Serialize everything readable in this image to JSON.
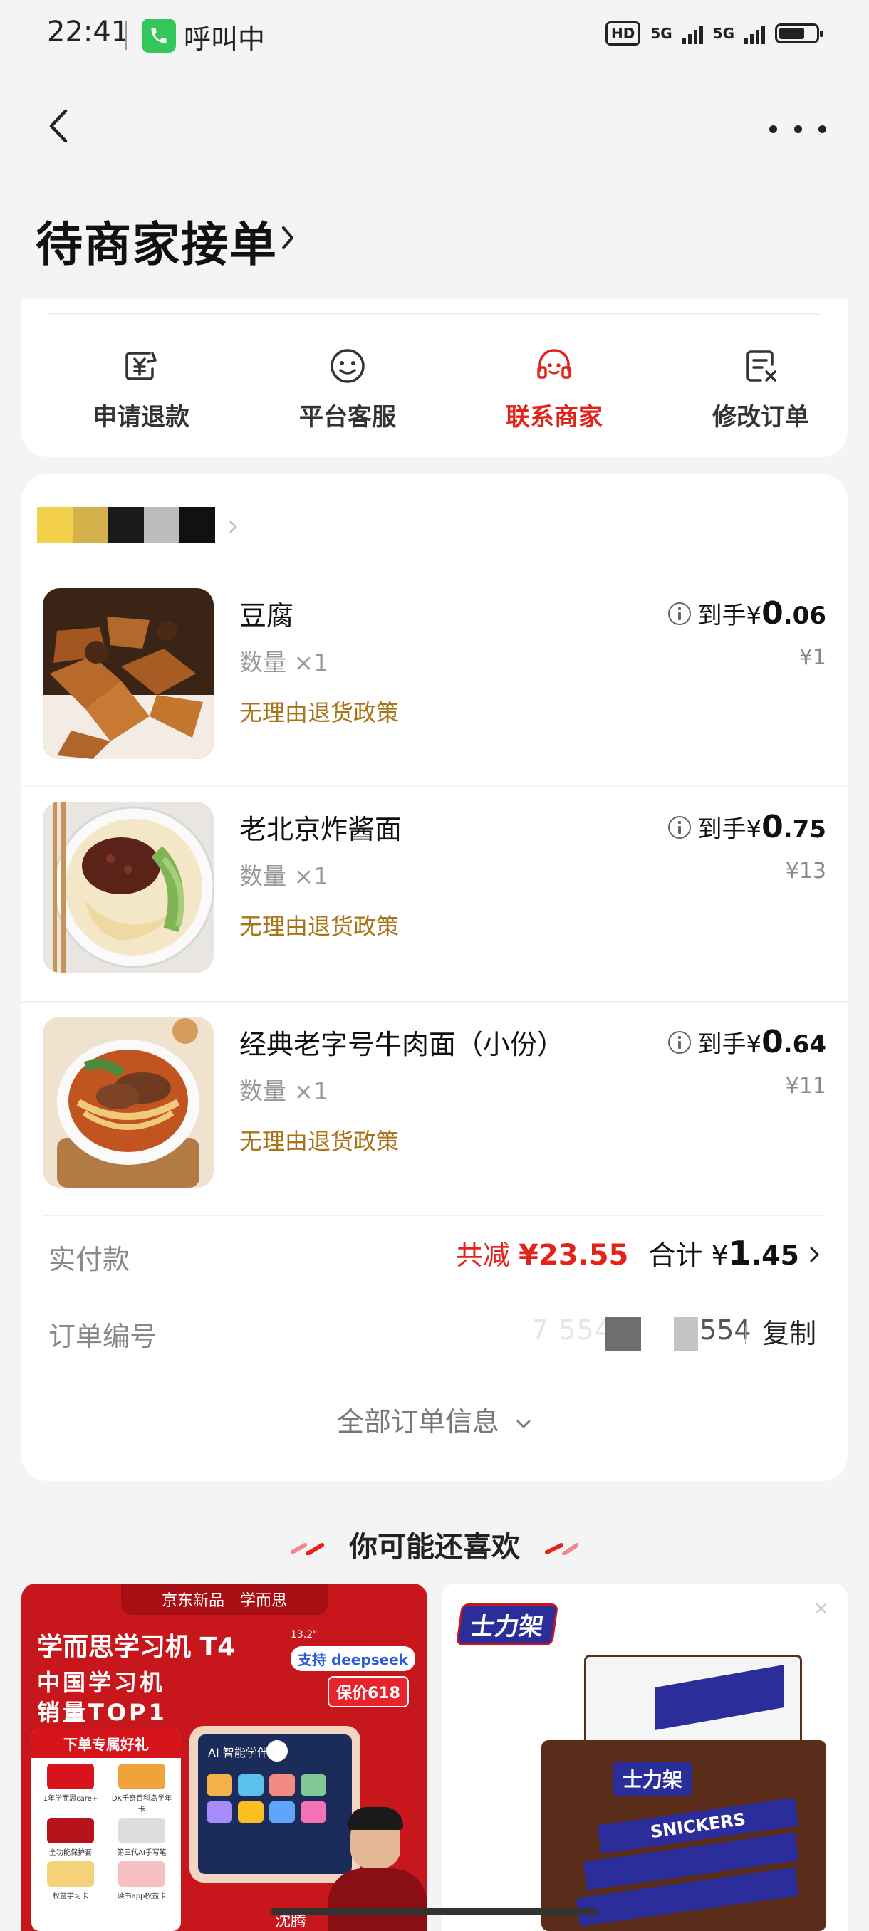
{
  "status_bar": {
    "time": "22:41",
    "call_status": "呼叫中",
    "hd": "HD",
    "net1": "5G",
    "net2": "5G"
  },
  "order": {
    "status_title": "待商家接单"
  },
  "actions": [
    {
      "label": "申请退款",
      "icon": "refund-icon"
    },
    {
      "label": "平台客服",
      "icon": "service-icon"
    },
    {
      "label": "联系商家",
      "icon": "merchant-icon",
      "highlight": true
    },
    {
      "label": "修改订单",
      "icon": "edit-order-icon"
    }
  ],
  "items": [
    {
      "name": "豆腐",
      "qty": "数量 ×1",
      "policy": "无理由退货政策",
      "price_prefix": "到手¥",
      "price_int": "0",
      "price_dec": ".06",
      "orig_price": "¥1"
    },
    {
      "name": "老北京炸酱面",
      "qty": "数量 ×1",
      "policy": "无理由退货政策",
      "price_prefix": "到手¥",
      "price_int": "0",
      "price_dec": ".75",
      "orig_price": "¥13"
    },
    {
      "name": "经典老字号牛肉面（小份）",
      "qty": "数量 ×1",
      "policy": "无理由退货政策",
      "price_prefix": "到手¥",
      "price_int": "0",
      "price_dec": ".64",
      "orig_price": "¥11"
    }
  ],
  "payment": {
    "label": "实付款",
    "discount_prefix": "共减 ",
    "discount": "¥23.55",
    "total_prefix": "合计 ¥",
    "total_int": "1",
    "total_dec": ".45"
  },
  "order_no": {
    "label": "订单编号",
    "value_visible": "7 554",
    "copy": "复制"
  },
  "all_info": "全部订单信息",
  "recommend": {
    "title": "你可能还喜欢",
    "ad1": {
      "top_left": "京东新品",
      "top_right": "学而思",
      "headline": "学而思学习机 T4",
      "size": "13.2\"",
      "support": "支持 deepseek",
      "tagline1": "中国学习机",
      "tagline2": "销量TOP1",
      "price_tag": "保价618",
      "gift_header": "下单专属好礼",
      "gifts": [
        "1年学而思care+",
        "DK千奇百科岛半年卡",
        "全功能保护套",
        "第三代AI手写笔",
        "权益学习卡",
        "读书app权益卡"
      ],
      "screen_title": "AI 智能学伴",
      "person": "沈腾"
    },
    "ad2": {
      "brand": "士力架",
      "product": "SNICKERS"
    }
  }
}
